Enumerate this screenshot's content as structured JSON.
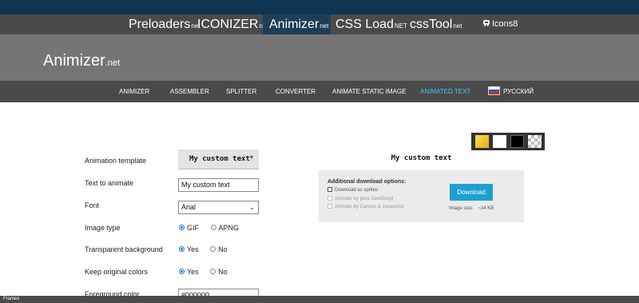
{
  "site_links": [
    {
      "main": "Preloaders",
      "suffix": "net"
    },
    {
      "main": "ICONIZER",
      "suffix": "net"
    },
    {
      "main": "Animizer",
      "suffix": "net"
    },
    {
      "main": "CSS Load",
      "suffix": "NET"
    },
    {
      "main": "cssTool",
      "suffix": "net"
    },
    {
      "main": "Icons8",
      "suffix": ""
    }
  ],
  "header": {
    "logo": "Animizer",
    "logo_suffix": ".net"
  },
  "nav": {
    "items": [
      "ANIMIZER",
      "ASSEMBLER",
      "SPLITTER",
      "CONVERTER",
      "ANIMATE STATIC IMAGE",
      "ANIMATED TEXT",
      "РУССКИЙ"
    ],
    "active": "ANIMATED TEXT"
  },
  "form": {
    "animation_template_label": "Animation template",
    "animation_template_value": "My custom text",
    "text_label": "Text to animate",
    "text_value": "My custom text",
    "font_label": "Font",
    "font_value": "Arial",
    "image_type_label": "Image type",
    "image_type_options": [
      "GIF",
      "APNG"
    ],
    "image_type_selected": "GIF",
    "transparent_label": "Transparent background",
    "transparent_options": [
      "Yes",
      "No"
    ],
    "transparent_selected": "Yes",
    "keep_colors_label": "Keep original colors",
    "keep_colors_options": [
      "Yes",
      "No"
    ],
    "keep_colors_selected": "Yes",
    "foreground_label": "Foreground color",
    "foreground_value": "#000000"
  },
  "preview_text": "My custom text",
  "swatch_colors": [
    "#f0c93a",
    "#ffffff",
    "#000000",
    "checkerboard"
  ],
  "download": {
    "title": "Additional download options:",
    "opt_sprites": "Download as sprites",
    "opt_js": "Animate by pure JavaScript",
    "opt_canvas": "Animate by Canvas & Javascript",
    "button": "Download",
    "size_label": "Image size:",
    "size_value": "~34 KB"
  },
  "bottom_bar": "Frames"
}
